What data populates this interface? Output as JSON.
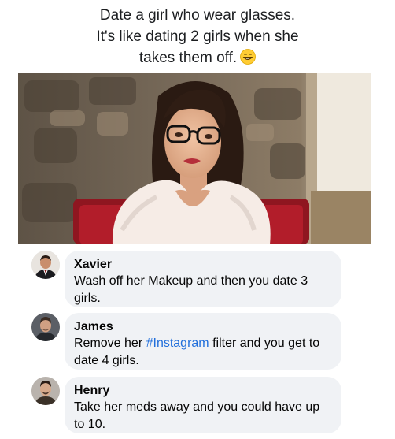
{
  "post": {
    "caption_line1": "Date a girl who wear glasses.",
    "caption_line2": "It's like dating 2 girls when she",
    "caption_line3": "takes them off.",
    "caption_emoji": "grinning-face-emoji",
    "photo": "woman-with-glasses-photo"
  },
  "comments": [
    {
      "author": "Xavier",
      "text": "Wash off her Makeup and then you date 3 girls.",
      "avatar": "xavier-avatar"
    },
    {
      "author": "James",
      "text_before": "Remove her ",
      "hashtag": "#Instagram",
      "text_after": " filter and you get to date 4 girls.",
      "avatar": "james-avatar"
    },
    {
      "author": "Henry",
      "text": "Take her meds away and you could have up to 10.",
      "avatar": "henry-avatar"
    }
  ],
  "colors": {
    "bubble": "#f0f2f5",
    "hashtag": "#216fdb",
    "text": "#050505"
  }
}
